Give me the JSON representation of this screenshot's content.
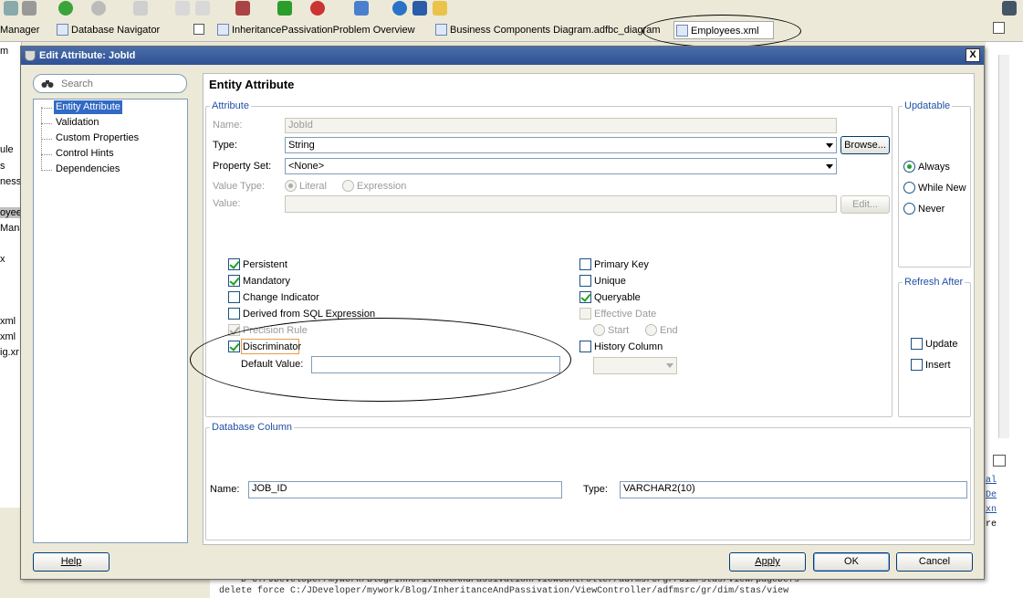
{
  "ide": {
    "tabs": {
      "manager": "Manager",
      "db_nav": "Database Navigator",
      "overview": "InheritancePassivationProblem Overview",
      "bc_diagram": "Business Components Diagram.adfbc_diagram",
      "employees": "Employees.xml"
    },
    "left_strip": [
      "m",
      "ule",
      "s",
      "ness",
      "oyee",
      "Mana",
      "x",
      "xml",
      "xml",
      "ig.xr"
    ],
    "log_lines": [
      "D C:/JDeveloper/mywork/Blog/InheritanceAndPassivation/ViewController/adfmsrc/gr/dim/stas/view/pageDefs",
      "delete   force C:/JDeveloper/mywork/Blog/InheritanceAndPassivation/ViewController/adfmsrc/gr/dim/stas/view"
    ],
    "right_strip": [
      "al",
      "De",
      "xn",
      "re"
    ]
  },
  "dialog": {
    "title": "Edit Attribute: JobId",
    "close": "X",
    "search_placeholder": "Search",
    "nav": [
      "Entity Attribute",
      "Validation",
      "Custom Properties",
      "Control Hints",
      "Dependencies"
    ],
    "panel_title": "Entity Attribute",
    "attribute": {
      "legend": "Attribute",
      "name_label": "Name:",
      "name_value": "JobId",
      "type_label": "Type:",
      "type_value": "String",
      "browse": "Browse...",
      "property_set_label": "Property Set:",
      "property_set_value": "<None>",
      "value_type_label": "Value Type:",
      "literal": "Literal",
      "expression": "Expression",
      "value_label": "Value:",
      "value_value": "",
      "edit": "Edit...",
      "persistent": "Persistent",
      "mandatory": "Mandatory",
      "change_indicator": "Change Indicator",
      "derived_sql": "Derived from SQL Expression",
      "precision_rule": "Precision Rule",
      "discriminator": "Discriminator",
      "default_value_label": "Default Value:",
      "default_value": "",
      "primary_key": "Primary Key",
      "unique": "Unique",
      "queryable": "Queryable",
      "effective_date": "Effective Date",
      "start": "Start",
      "end": "End",
      "history_column": "History Column"
    },
    "updatable": {
      "legend": "Updatable",
      "always": "Always",
      "while_new": "While New",
      "never": "Never",
      "selected": "Always"
    },
    "refresh_after": {
      "legend": "Refresh After",
      "update": "Update",
      "insert": "Insert"
    },
    "database_column": {
      "legend": "Database Column",
      "name_label": "Name:",
      "name_value": "JOB_ID",
      "type_label": "Type:",
      "type_value": "VARCHAR2(10)"
    },
    "buttons": {
      "help": "Help",
      "apply": "Apply",
      "ok": "OK",
      "cancel": "Cancel"
    },
    "checkbox_states": {
      "persistent": true,
      "mandatory": true,
      "change_indicator": false,
      "derived_sql": false,
      "precision_rule": true,
      "discriminator": true,
      "primary_key": false,
      "unique": false,
      "queryable": true,
      "effective_date": false,
      "history_column": false,
      "refresh_update": false,
      "refresh_insert": false
    }
  }
}
